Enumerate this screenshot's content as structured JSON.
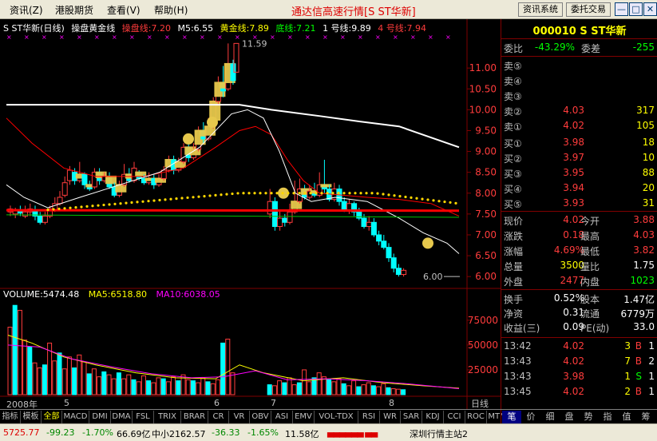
{
  "menubar": {
    "items": [
      "资讯(̲Z)",
      "港股期货",
      "查看(V̲)",
      "帮助(H̲)"
    ],
    "items_display": [
      "资讯(Z)",
      "港股期货",
      "查看(V)",
      "帮助(H)"
    ],
    "title": "通达信高速行情[S ST华新]",
    "btn_info": "资讯系统",
    "btn_trade": "委托交易"
  },
  "chart": {
    "header": {
      "name": "S ST华新(日线)",
      "indicator": "操盘黄金线",
      "caopan": "操盘线:7.20",
      "m5": "M5:6.55",
      "huangjin": "黄金线:7.89",
      "dixian": "底线:7.21",
      "line1": "1 号线:9.89",
      "line4": "4 号线:7.94"
    },
    "high_mark": "11.59",
    "low_mark": "6.00",
    "price_ticks": [
      "11.00",
      "10.50",
      "10.00",
      "9.50",
      "9.00",
      "8.50",
      "8.00",
      "7.50",
      "7.00",
      "6.50",
      "6.00"
    ],
    "vol_header": {
      "volume": "VOLUME:5474.48",
      "ma5": "MA5:6518.80",
      "ma10": "MA10:6038.05"
    },
    "vol_ticks": [
      "75000",
      "50000",
      "25000"
    ],
    "x_labels": [
      "2008年",
      "5",
      "6",
      "7",
      "8"
    ],
    "period": "日线"
  },
  "chart_data": {
    "type": "bar",
    "title": "S ST华新(日线)",
    "price_range": [
      6.0,
      11.59
    ],
    "volume_range": [
      0,
      90000
    ],
    "volume": 5474.48,
    "ma5": 6518.8,
    "ma10": 6038.05
  },
  "tabs": [
    "指标",
    "模板",
    "全部",
    "MACD",
    "DMI",
    "DMA",
    "FSL",
    "TRIX",
    "BRAR",
    "CR",
    "VR",
    "OBV",
    "ASI",
    "EMV",
    "VOL-TDX",
    "RSI",
    "WR",
    "SAR",
    "KDJ",
    "CCI",
    "ROC",
    "MTM"
  ],
  "panel": {
    "code_name": "000010 S ST华新",
    "weibi_label": "委比",
    "weibi": "-43.29%",
    "weicha_label": "委差",
    "weicha": "-255",
    "sells": [
      {
        "label": "卖⑤",
        "price": "",
        "vol": ""
      },
      {
        "label": "卖④",
        "price": "",
        "vol": ""
      },
      {
        "label": "卖③",
        "price": "",
        "vol": ""
      },
      {
        "label": "卖②",
        "price": "4.03",
        "vol": "317"
      },
      {
        "label": "卖①",
        "price": "4.02",
        "vol": "105"
      }
    ],
    "buys": [
      {
        "label": "买①",
        "price": "3.98",
        "vol": "18"
      },
      {
        "label": "买②",
        "price": "3.97",
        "vol": "10"
      },
      {
        "label": "买③",
        "price": "3.95",
        "vol": "88"
      },
      {
        "label": "买④",
        "price": "3.94",
        "vol": "20"
      },
      {
        "label": "买⑤",
        "price": "3.93",
        "vol": "31"
      }
    ],
    "stats": [
      {
        "l1": "现价",
        "v1": "4.02",
        "c1": "red",
        "l2": "今开",
        "v2": "3.88",
        "c2": "red"
      },
      {
        "l1": "涨跌",
        "v1": "0.18",
        "c1": "red",
        "l2": "最高",
        "v2": "4.03",
        "c2": "red"
      },
      {
        "l1": "涨幅",
        "v1": "4.69%",
        "c1": "red",
        "l2": "最低",
        "v2": "3.82",
        "c2": "red"
      },
      {
        "l1": "总量",
        "v1": "3500",
        "c1": "yellow",
        "l2": "量比",
        "v2": "1.75",
        "c2": "white"
      },
      {
        "l1": "外盘",
        "v1": "2477",
        "c1": "red",
        "l2": "内盘",
        "v2": "1023",
        "c2": "green"
      }
    ],
    "stats2": [
      {
        "l1": "换手",
        "v1": "0.52%",
        "l2": "股本",
        "v2": "1.47亿"
      },
      {
        "l1": "净资",
        "v1": "0.31",
        "l2": "流通",
        "v2": "6779万"
      },
      {
        "l1": "收益(三)",
        "v1": "0.09",
        "l2": "PE(动)",
        "v2": "33.0"
      }
    ],
    "trades": [
      {
        "time": "13:42",
        "price": "4.02",
        "pc": "red",
        "vol": "3",
        "bs": "B",
        "bc": "red",
        "n": "1"
      },
      {
        "time": "13:43",
        "price": "4.02",
        "pc": "red",
        "vol": "7",
        "bs": "B",
        "bc": "red",
        "n": "2"
      },
      {
        "time": "13:43",
        "price": "3.98",
        "pc": "red",
        "vol": "1",
        "bs": "S",
        "bc": "green",
        "n": "1"
      },
      {
        "time": "13:45",
        "price": "4.02",
        "pc": "red",
        "vol": "2",
        "bs": "B",
        "bc": "red",
        "n": "1"
      }
    ]
  },
  "panel_tabs": [
    "笔",
    "价",
    "细",
    "盘",
    "势",
    "指",
    "值",
    "筹"
  ],
  "status": {
    "sh_index": "5725.77",
    "sh_change": "-99.23",
    "sh_pct": "-1.70%",
    "sh_amount": "66.69亿",
    "zx_label": "中小2162.57",
    "zx_change": "-36.33",
    "zx_pct": "-1.65%",
    "zx_amount": "11.58亿",
    "server": "深圳行情主站2"
  },
  "colors": {
    "up": "#ff3c3c",
    "down": "#00ffff",
    "gold": "#e6c84c",
    "ma_white": "#ffffff",
    "ma_red": "#ff0000",
    "ma_green": "#00c000",
    "dots": "#ffd700"
  }
}
